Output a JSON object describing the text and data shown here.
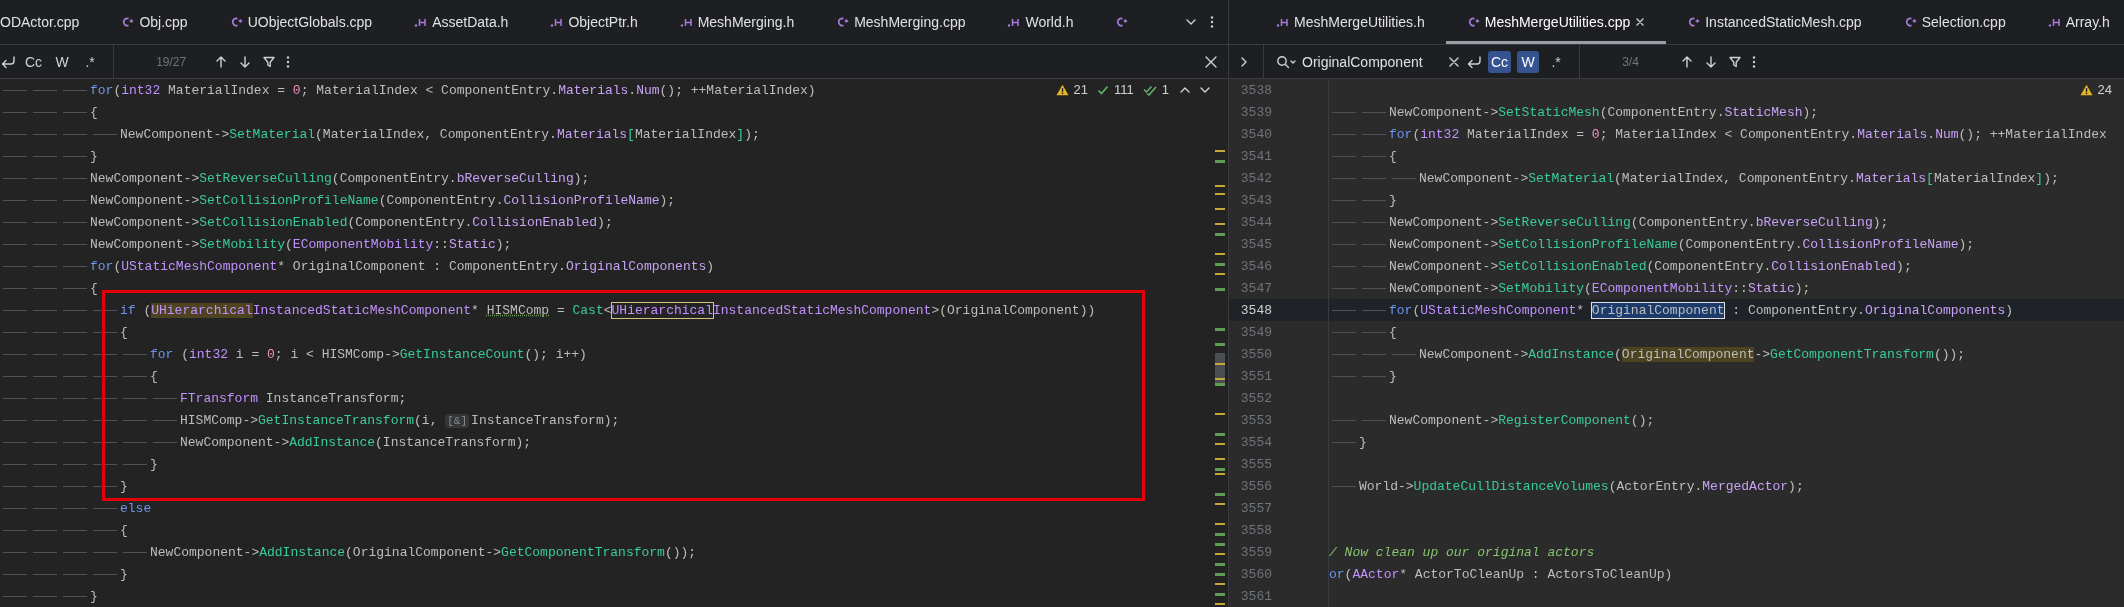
{
  "left_pane": {
    "tabs": [
      {
        "label": "ODActor.cpp",
        "selected": false
      },
      {
        "label": "Obj.cpp",
        "kind": "cpp",
        "selected": false
      },
      {
        "label": "UObjectGlobals.cpp",
        "kind": "cpp",
        "selected": false
      },
      {
        "label": "AssetData.h",
        "kind": "h",
        "selected": false
      },
      {
        "label": "ObjectPtr.h",
        "kind": "h",
        "selected": false
      },
      {
        "label": "MeshMerging.h",
        "kind": "h",
        "selected": false
      },
      {
        "label": "MeshMerging.cpp",
        "kind": "cpp",
        "selected": false
      },
      {
        "label": "World.h",
        "kind": "h",
        "selected": false
      },
      {
        "kind": "cpp",
        "selected": false
      }
    ],
    "find_bar": {
      "toggles": [
        {
          "label": "Cc",
          "on": false
        },
        {
          "label": "W",
          "on": false
        },
        {
          "label": ".*",
          "on": false
        }
      ],
      "match_count": "19/27",
      "closable": true
    },
    "inspections": [
      {
        "kind": "warning",
        "count": "21"
      },
      {
        "kind": "ok",
        "count": "111"
      },
      {
        "kind": "typo",
        "count": "1"
      }
    ],
    "nav_arrows": true,
    "lines": [
      {
        "tokens": [
          {
            "text": "\t\t\tfor",
            "kind": "keyword"
          },
          {
            "text": "(",
            "kind": "plain"
          },
          {
            "text": "int32",
            "kind": "type"
          },
          {
            "text": " MaterialIndex = ",
            "kind": "plain"
          },
          {
            "text": "0",
            "kind": "number"
          },
          {
            "text": "; MaterialIndex < ComponentEntry.",
            "kind": "plain"
          },
          {
            "text": "Materials",
            "kind": "member"
          },
          {
            "text": ".",
            "kind": "plain"
          },
          {
            "text": "Num",
            "kind": "member"
          },
          {
            "text": "(); ++MaterialIndex)",
            "kind": "plain"
          }
        ]
      },
      {
        "tokens": [
          {
            "text": "\t\t\t{",
            "kind": "plain"
          }
        ]
      },
      {
        "tokens": [
          {
            "text": "\t\t\t\tNewComponent->",
            "kind": "plain"
          },
          {
            "text": "SetMaterial",
            "kind": "function"
          },
          {
            "text": "(MaterialIndex, ComponentEntry.",
            "kind": "plain"
          },
          {
            "text": "Materials",
            "kind": "member"
          },
          {
            "text": "[",
            "kind": "bracket"
          },
          {
            "text": "MaterialIndex",
            "kind": "plain"
          },
          {
            "text": "]",
            "kind": "bracket"
          },
          {
            "text": ");",
            "kind": "plain"
          }
        ]
      },
      {
        "tokens": [
          {
            "text": "\t\t\t}",
            "kind": "plain"
          }
        ]
      },
      {
        "tokens": [
          {
            "text": "\t\t\tNewComponent->",
            "kind": "plain"
          },
          {
            "text": "SetReverseCulling",
            "kind": "function"
          },
          {
            "text": "(ComponentEntry.",
            "kind": "plain"
          },
          {
            "text": "bReverseCulling",
            "kind": "member"
          },
          {
            "text": ");",
            "kind": "plain"
          }
        ]
      },
      {
        "tokens": [
          {
            "text": "\t\t\tNewComponent->",
            "kind": "plain"
          },
          {
            "text": "SetCollisionProfileName",
            "kind": "function"
          },
          {
            "text": "(ComponentEntry.",
            "kind": "plain"
          },
          {
            "text": "CollisionProfileName",
            "kind": "member"
          },
          {
            "text": ");",
            "kind": "plain"
          }
        ]
      },
      {
        "tokens": [
          {
            "text": "\t\t\tNewComponent->",
            "kind": "plain"
          },
          {
            "text": "SetCollisionEnabled",
            "kind": "function"
          },
          {
            "text": "(ComponentEntry.",
            "kind": "plain"
          },
          {
            "text": "CollisionEnabled",
            "kind": "member"
          },
          {
            "text": ");",
            "kind": "plain"
          }
        ]
      },
      {
        "tokens": [
          {
            "text": "\t\t\tNewComponent->",
            "kind": "plain"
          },
          {
            "text": "SetMobility",
            "kind": "function"
          },
          {
            "text": "(",
            "kind": "plain"
          },
          {
            "text": "EComponentMobility",
            "kind": "type"
          },
          {
            "text": "::",
            "kind": "plain"
          },
          {
            "text": "Static",
            "kind": "member"
          },
          {
            "text": ");",
            "kind": "plain"
          }
        ]
      },
      {
        "tokens": [
          {
            "text": "\t\t\tfor",
            "kind": "keyword"
          },
          {
            "text": "(",
            "kind": "plain"
          },
          {
            "text": "UStaticMeshComponent",
            "kind": "type"
          },
          {
            "text": "* OriginalComponent : ComponentEntry.",
            "kind": "plain"
          },
          {
            "text": "OriginalComponents",
            "kind": "member"
          },
          {
            "text": ")",
            "kind": "plain"
          }
        ]
      },
      {
        "tokens": [
          {
            "text": "\t\t\t{",
            "kind": "plain"
          }
        ]
      },
      {
        "kind": "framed_block",
        "lines": [
          {
            "tokens": [
              {
                "text": "\t\t\t\tif",
                "kind": "keyword"
              },
              {
                "text": " (",
                "kind": "plain"
              },
              {
                "text": "UHierarchical",
                "kind": "type",
                "occurrence": true
              },
              {
                "text": "InstancedStaticMeshComponent",
                "kind": "type"
              },
              {
                "text": "* ",
                "kind": "plain"
              },
              {
                "text": "HISMComp",
                "kind": "plain",
                "underlined": true
              },
              {
                "text": " = ",
                "kind": "plain"
              },
              {
                "text": "Cast",
                "kind": "function"
              },
              {
                "text": "<",
                "kind": "plain"
              },
              {
                "text": "UHierarchical",
                "kind": "type",
                "outlined": true
              },
              {
                "text": "InstancedStaticMeshComponent",
                "kind": "type"
              },
              {
                "text": ">(OriginalComponent))",
                "kind": "plain"
              }
            ]
          },
          {
            "tokens": [
              {
                "text": "\t\t\t\t{",
                "kind": "plain"
              }
            ]
          },
          {
            "tokens": [
              {
                "text": "\t\t\t\t\tfor",
                "kind": "keyword"
              },
              {
                "text": " (",
                "kind": "plain"
              },
              {
                "text": "int32",
                "kind": "type"
              },
              {
                "text": " i = ",
                "kind": "plain"
              },
              {
                "text": "0",
                "kind": "number"
              },
              {
                "text": "; i < HISMComp->",
                "kind": "plain"
              },
              {
                "text": "GetInstanceCount",
                "kind": "function"
              },
              {
                "text": "(); i++)",
                "kind": "plain"
              }
            ]
          },
          {
            "tokens": [
              {
                "text": "\t\t\t\t\t{",
                "kind": "plain"
              }
            ]
          },
          {
            "tokens": [
              {
                "text": "\t\t\t\t\t\tFTransform",
                "kind": "type"
              },
              {
                "text": " InstanceTransform;",
                "kind": "plain"
              }
            ]
          },
          {
            "tokens": [
              {
                "text": "\t\t\t\t\t\tHISMComp->",
                "kind": "plain"
              },
              {
                "text": "GetInstanceTransform",
                "kind": "function"
              },
              {
                "text": "(i, ",
                "kind": "plain"
              },
              {
                "text": "[&]",
                "kind": "hint"
              },
              {
                "text": "InstanceTransform);",
                "kind": "plain"
              }
            ]
          },
          {
            "tokens": [
              {
                "text": "\t\t\t\t\t\tNewComponent->",
                "kind": "plain"
              },
              {
                "text": "AddInstance",
                "kind": "function"
              },
              {
                "text": "(InstanceTransform);",
                "kind": "plain"
              }
            ]
          },
          {
            "tokens": [
              {
                "text": "\t\t\t\t\t}",
                "kind": "plain"
              }
            ]
          },
          {
            "tokens": [
              {
                "text": "\t\t\t\t}",
                "kind": "plain"
              }
            ]
          }
        ]
      },
      {
        "tokens": [
          {
            "text": "\t\t\t\telse",
            "kind": "keyword"
          }
        ]
      },
      {
        "tokens": [
          {
            "text": "\t\t\t\t{",
            "kind": "plain"
          }
        ]
      },
      {
        "tokens": [
          {
            "text": "\t\t\t\t\tNewComponent->",
            "kind": "plain"
          },
          {
            "text": "AddInstance",
            "kind": "function"
          },
          {
            "text": "(OriginalComponent->",
            "kind": "plain"
          },
          {
            "text": "GetComponentTransform",
            "kind": "function"
          },
          {
            "text": "());",
            "kind": "plain"
          }
        ]
      },
      {
        "tokens": [
          {
            "text": "\t\t\t\t}",
            "kind": "plain"
          }
        ]
      },
      {
        "tokens": [
          {
            "text": "\t\t\t}",
            "kind": "plain"
          }
        ]
      }
    ]
  },
  "right_pane": {
    "tabs": [
      {
        "label": "MeshMergeUtilities.h",
        "kind": "h",
        "selected": false
      },
      {
        "label": "MeshMergeUtilities.cpp",
        "kind": "cpp",
        "selected": true
      },
      {
        "label": "InstancedStaticMesh.cpp",
        "kind": "cpp",
        "selected": false
      },
      {
        "label": "Selection.cpp",
        "kind": "cpp",
        "selected": false
      },
      {
        "label": "Array.h",
        "kind": "h",
        "selected": false
      }
    ],
    "find_bar": {
      "expand_toggle": true,
      "query": "OriginalComponent",
      "toggles": [
        {
          "label": "Cc",
          "on": true
        },
        {
          "label": "W",
          "on": true
        },
        {
          "label": ".*",
          "on": false
        }
      ],
      "match_count": "3/4"
    },
    "inspections": [
      {
        "kind": "warning",
        "count": "24"
      }
    ],
    "lines": [
      {
        "number": "3538",
        "current": false
      },
      {
        "number": "3539",
        "current": false,
        "tokens": [
          {
            "text": "\t\tNewComponent->",
            "kind": "plain"
          },
          {
            "text": "SetStaticMesh",
            "kind": "function"
          },
          {
            "text": "(ComponentEntry.",
            "kind": "plain"
          },
          {
            "text": "StaticMesh",
            "kind": "member"
          },
          {
            "text": ");",
            "kind": "plain"
          }
        ]
      },
      {
        "number": "3540",
        "current": false,
        "tokens": [
          {
            "text": "\t\tfor",
            "kind": "keyword"
          },
          {
            "text": "(",
            "kind": "plain"
          },
          {
            "text": "int32",
            "kind": "type"
          },
          {
            "text": " MaterialIndex = ",
            "kind": "plain"
          },
          {
            "text": "0",
            "kind": "number"
          },
          {
            "text": "; MaterialIndex < ComponentEntry.",
            "kind": "plain"
          },
          {
            "text": "Materials",
            "kind": "member"
          },
          {
            "text": ".",
            "kind": "plain"
          },
          {
            "text": "Num",
            "kind": "member"
          },
          {
            "text": "(); ++MaterialIndex",
            "kind": "plain"
          }
        ]
      },
      {
        "number": "3541",
        "current": false,
        "tokens": [
          {
            "text": "\t\t{",
            "kind": "plain"
          }
        ]
      },
      {
        "number": "3542",
        "current": false,
        "tokens": [
          {
            "text": "\t\t\tNewComponent->",
            "kind": "plain"
          },
          {
            "text": "SetMaterial",
            "kind": "function"
          },
          {
            "text": "(MaterialIndex, ComponentEntry.",
            "kind": "plain"
          },
          {
            "text": "Materials",
            "kind": "member"
          },
          {
            "text": "[",
            "kind": "bracket"
          },
          {
            "text": "MaterialIndex",
            "kind": "plain"
          },
          {
            "text": "]",
            "kind": "bracket"
          },
          {
            "text": ");",
            "kind": "plain"
          }
        ]
      },
      {
        "number": "3543",
        "current": false,
        "tokens": [
          {
            "text": "\t\t}",
            "kind": "plain"
          }
        ]
      },
      {
        "number": "3544",
        "current": false,
        "tokens": [
          {
            "text": "\t\tNewComponent->",
            "kind": "plain"
          },
          {
            "text": "SetReverseCulling",
            "kind": "function"
          },
          {
            "text": "(ComponentEntry.",
            "kind": "plain"
          },
          {
            "text": "bReverseCulling",
            "kind": "member"
          },
          {
            "text": ");",
            "kind": "plain"
          }
        ]
      },
      {
        "number": "3545",
        "current": false,
        "tokens": [
          {
            "text": "\t\tNewComponent->",
            "kind": "plain"
          },
          {
            "text": "SetCollisionProfileName",
            "kind": "function"
          },
          {
            "text": "(ComponentEntry.",
            "kind": "plain"
          },
          {
            "text": "CollisionProfileName",
            "kind": "member"
          },
          {
            "text": ");",
            "kind": "plain"
          }
        ]
      },
      {
        "number": "3546",
        "current": false,
        "tokens": [
          {
            "text": "\t\tNewComponent->",
            "kind": "plain"
          },
          {
            "text": "SetCollisionEnabled",
            "kind": "function"
          },
          {
            "text": "(ComponentEntry.",
            "kind": "plain"
          },
          {
            "text": "CollisionEnabled",
            "kind": "member"
          },
          {
            "text": ");",
            "kind": "plain"
          }
        ]
      },
      {
        "number": "3547",
        "current": false,
        "tokens": [
          {
            "text": "\t\tNewComponent->",
            "kind": "plain"
          },
          {
            "text": "SetMobility",
            "kind": "function"
          },
          {
            "text": "(",
            "kind": "plain"
          },
          {
            "text": "EComponentMobility",
            "kind": "type"
          },
          {
            "text": "::",
            "kind": "plain"
          },
          {
            "text": "Static",
            "kind": "member"
          },
          {
            "text": ");",
            "kind": "plain"
          }
        ]
      },
      {
        "number": "3548",
        "current": true,
        "tokens": [
          {
            "text": "\t\tfor",
            "kind": "keyword"
          },
          {
            "text": "(",
            "kind": "plain"
          },
          {
            "text": "UStaticMeshComponent",
            "kind": "type"
          },
          {
            "text": "* ",
            "kind": "plain"
          },
          {
            "text": "OriginalComponent",
            "kind": "plain",
            "current_match": true
          },
          {
            "text": " : ComponentEntry.",
            "kind": "plain"
          },
          {
            "text": "OriginalComponents",
            "kind": "member"
          },
          {
            "text": ")",
            "kind": "plain"
          }
        ]
      },
      {
        "number": "3549",
        "current": false,
        "tokens": [
          {
            "text": "\t\t{",
            "kind": "plain"
          }
        ]
      },
      {
        "number": "3550",
        "current": false,
        "tokens": [
          {
            "text": "\t\t\tNewComponent->",
            "kind": "plain"
          },
          {
            "text": "AddInstance",
            "kind": "function"
          },
          {
            "text": "(",
            "kind": "plain"
          },
          {
            "text": "OriginalComponent",
            "kind": "plain",
            "occurrence": true
          },
          {
            "text": "->",
            "kind": "plain"
          },
          {
            "text": "GetComponentTransform",
            "kind": "function"
          },
          {
            "text": "());",
            "kind": "plain"
          }
        ]
      },
      {
        "number": "3551",
        "current": false,
        "tokens": [
          {
            "text": "\t\t}",
            "kind": "plain"
          }
        ]
      },
      {
        "number": "3552",
        "current": false
      },
      {
        "number": "3553",
        "current": false,
        "tokens": [
          {
            "text": "\t\tNewComponent->",
            "kind": "plain"
          },
          {
            "text": "RegisterComponent",
            "kind": "function"
          },
          {
            "text": "();",
            "kind": "plain"
          }
        ]
      },
      {
        "number": "3554",
        "current": false,
        "tokens": [
          {
            "text": "\t}",
            "kind": "plain"
          }
        ]
      },
      {
        "number": "3555",
        "current": false
      },
      {
        "number": "3556",
        "current": false,
        "tokens": [
          {
            "text": "\tWorld->",
            "kind": "plain"
          },
          {
            "text": "UpdateCullDistanceVolumes",
            "kind": "function"
          },
          {
            "text": "(ActorEntry.",
            "kind": "plain"
          },
          {
            "text": "MergedActor",
            "kind": "member"
          },
          {
            "text": ");",
            "kind": "plain"
          }
        ]
      },
      {
        "number": "3557",
        "current": false
      },
      {
        "number": "3558",
        "current": false
      },
      {
        "number": "3559",
        "current": false,
        "tokens": [
          {
            "text": "/ Now clean up our original actors",
            "kind": "comment"
          }
        ]
      },
      {
        "number": "3560",
        "current": false,
        "tokens": [
          {
            "text": "or",
            "kind": "keyword"
          },
          {
            "text": "(",
            "kind": "plain"
          },
          {
            "text": "AActor",
            "kind": "type"
          },
          {
            "text": "* ActorToCleanUp : ActorsToCleanUp)",
            "kind": "plain"
          }
        ]
      },
      {
        "number": "3561",
        "current": false
      }
    ]
  }
}
